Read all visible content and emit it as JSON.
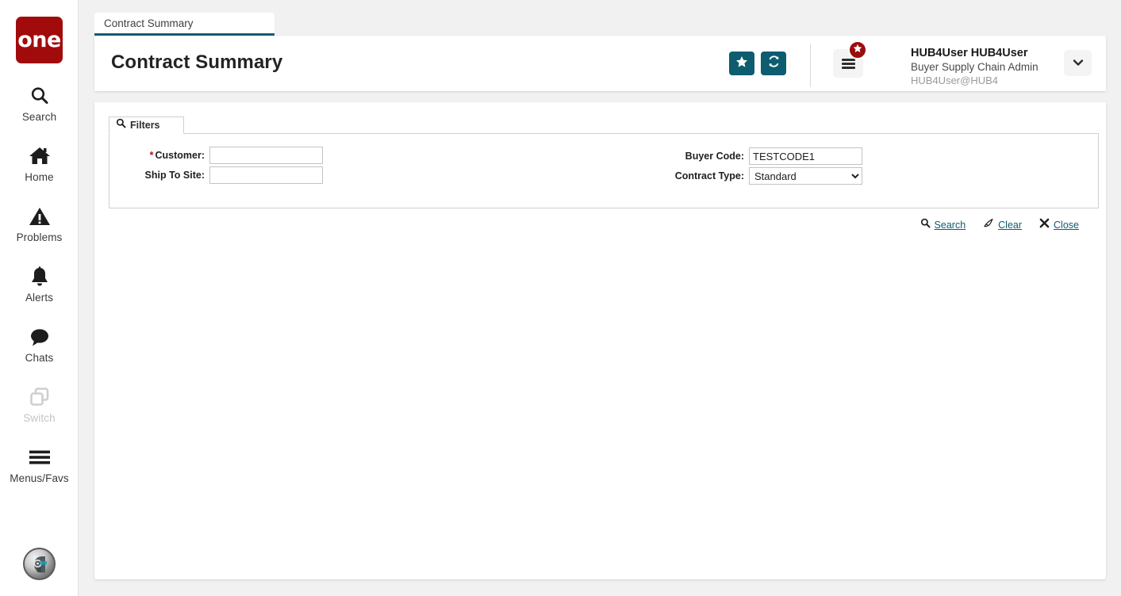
{
  "app": {
    "logo_text": "one",
    "brand_color": "#a20b0b",
    "accent_color": "#0d5c70"
  },
  "sidebar": {
    "items": [
      {
        "label": "Search",
        "icon": "search-icon",
        "disabled": false
      },
      {
        "label": "Home",
        "icon": "home-icon",
        "disabled": false
      },
      {
        "label": "Problems",
        "icon": "warning-icon",
        "disabled": false
      },
      {
        "label": "Alerts",
        "icon": "bell-icon",
        "disabled": false
      },
      {
        "label": "Chats",
        "icon": "chat-icon",
        "disabled": false
      },
      {
        "label": "Switch",
        "icon": "switch-icon",
        "disabled": true
      },
      {
        "label": "Menus/Favs",
        "icon": "hamburger-icon",
        "disabled": false
      }
    ],
    "assistant_icon": "assistant-avatar-icon"
  },
  "tab": {
    "label": "Contract Summary"
  },
  "header": {
    "title": "Contract Summary",
    "favorite_icon": "star-icon",
    "refresh_icon": "refresh-icon",
    "menus_icon": "hamburger-icon",
    "menus_badge_icon": "star-icon",
    "user_menu_icon": "chevron-down-icon",
    "user": {
      "name": "HUB4User HUB4User",
      "role": "Buyer Supply Chain Admin",
      "id": "HUB4User@HUB4"
    }
  },
  "filters": {
    "tab_label": "Filters",
    "tab_icon": "search-icon",
    "fields": {
      "customer": {
        "label": "Customer:",
        "required_marker": "*",
        "value": "",
        "placeholder": ""
      },
      "ship_to_site": {
        "label": "Ship To Site:",
        "value": "",
        "placeholder": ""
      },
      "buyer_code": {
        "label": "Buyer Code:",
        "value": "TESTCODE1",
        "placeholder": ""
      },
      "contract_type": {
        "label": "Contract Type:",
        "value": "Standard",
        "options": [
          "Standard"
        ]
      }
    },
    "actions": [
      {
        "label": "Search",
        "icon": "search-icon"
      },
      {
        "label": "Clear",
        "icon": "eraser-icon"
      },
      {
        "label": "Close",
        "icon": "close-icon"
      }
    ]
  }
}
